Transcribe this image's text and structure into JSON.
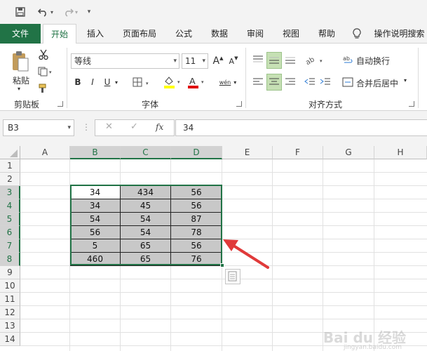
{
  "qat": {
    "more": "▾"
  },
  "tabs": [
    {
      "label": "文件"
    },
    {
      "label": "开始"
    },
    {
      "label": "插入"
    },
    {
      "label": "页面布局"
    },
    {
      "label": "公式"
    },
    {
      "label": "数据"
    },
    {
      "label": "审阅"
    },
    {
      "label": "视图"
    },
    {
      "label": "帮助"
    },
    {
      "label": "操作说明搜索"
    }
  ],
  "ribbon": {
    "clipboard": {
      "paste_label": "粘贴",
      "group_label": "剪贴板"
    },
    "font": {
      "font_name": "等线",
      "font_size": "11",
      "bold": "B",
      "italic": "I",
      "underline": "U",
      "fill_icon": "paint-bucket-icon",
      "font_color_icon": "font-color-icon",
      "font_color": "#e00000",
      "fill_color": "#ffff00",
      "phonetic": "wén",
      "group_label": "字体"
    },
    "alignment": {
      "wrap_text": "自动换行",
      "merge_center": "合并后居中",
      "group_label": "对齐方式"
    }
  },
  "formula_bar": {
    "name_box": "B3",
    "formula": "34",
    "fx": "fx",
    "cancel": "✕",
    "enter": "✓"
  },
  "sheet": {
    "columns": [
      "A",
      "B",
      "C",
      "D",
      "E",
      "F",
      "G",
      "H"
    ],
    "rows": [
      "1",
      "2",
      "3",
      "4",
      "5",
      "6",
      "7",
      "8",
      "9",
      "10",
      "11",
      "12",
      "13",
      "14"
    ],
    "data": [
      [
        "34",
        "434",
        "56"
      ],
      [
        "34",
        "45",
        "56"
      ],
      [
        "54",
        "54",
        "87"
      ],
      [
        "56",
        "54",
        "78"
      ],
      [
        "5",
        "65",
        "56"
      ],
      [
        "460",
        "65",
        "76"
      ]
    ],
    "selection": "B3:D8",
    "accent": "#217346"
  },
  "watermark": {
    "text": "Bai du 经验",
    "sub": "jingyan.baidu.com"
  }
}
